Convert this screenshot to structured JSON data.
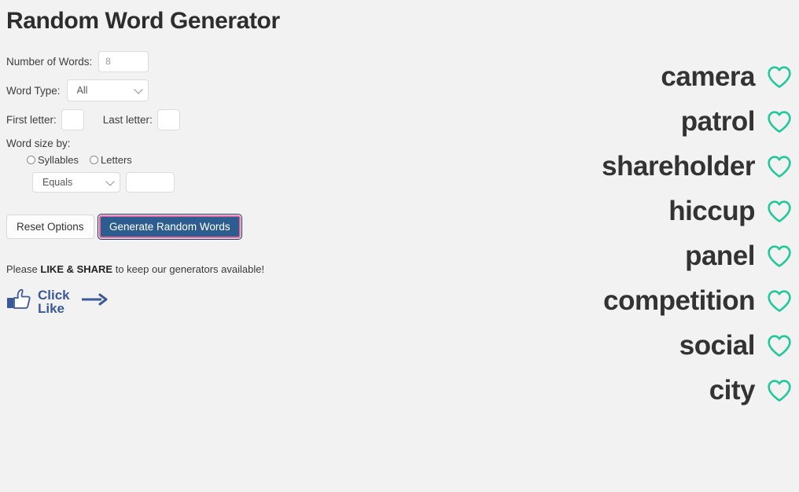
{
  "page": {
    "title": "Random Word Generator",
    "background_color": "#f2f2f2"
  },
  "form": {
    "number_of_words": {
      "label": "Number of Words:",
      "value": "8"
    },
    "word_type": {
      "label": "Word Type:",
      "value": "All",
      "options": [
        "All"
      ]
    },
    "first_letter": {
      "label": "First letter:",
      "value": ""
    },
    "last_letter": {
      "label": "Last letter:",
      "value": ""
    },
    "word_size": {
      "label": "Word size by:",
      "radio_syllables": "Syllables",
      "radio_letters": "Letters",
      "operator": {
        "value": "Equals",
        "options": [
          "Equals"
        ]
      },
      "size_value": ""
    },
    "reset_label": "Reset Options",
    "generate_label": "Generate Random Words",
    "generate_fill_color": "#2d5d8e",
    "generate_border_color": "#e56ba4",
    "generate_focus_color": "#23305e"
  },
  "share": {
    "note_prefix": "Please ",
    "note_bold": "LIKE & SHARE",
    "note_suffix": " to keep our generators available!",
    "click_line1": "Click",
    "click_line2": "Like",
    "brand_color": "#3b5998",
    "thumb_icon": "thumbs-up-icon",
    "arrow_icon": "arrow-right-icon"
  },
  "results": {
    "heart_color": "#22c79a",
    "heart_icon": "heart-outline-icon",
    "words": [
      "camera",
      "patrol",
      "shareholder",
      "hiccup",
      "panel",
      "competition",
      "social",
      "city"
    ]
  }
}
